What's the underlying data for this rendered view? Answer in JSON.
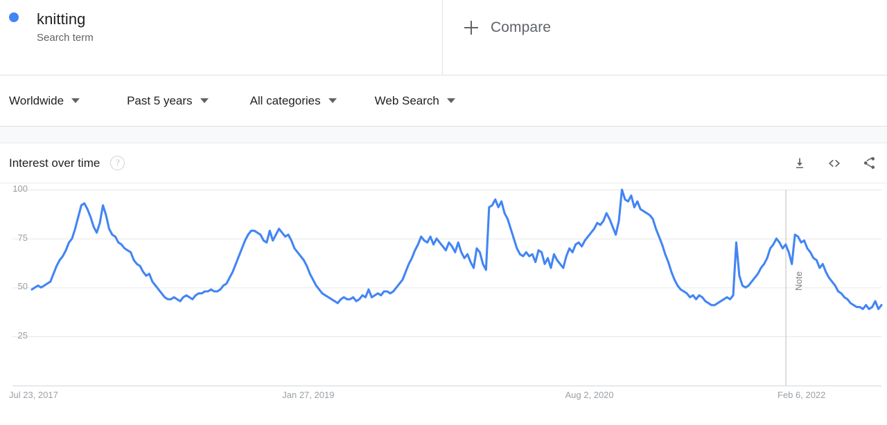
{
  "term": {
    "name": "knitting",
    "type_label": "Search term",
    "dot_color": "#4285f4"
  },
  "compare": {
    "label": "Compare",
    "icon": "plus-icon"
  },
  "filters": [
    {
      "label": "Worldwide",
      "icon": "chevron-down-icon"
    },
    {
      "label": "Past 5 years",
      "icon": "chevron-down-icon"
    },
    {
      "label": "All categories",
      "icon": "chevron-down-icon"
    },
    {
      "label": "Web Search",
      "icon": "chevron-down-icon"
    }
  ],
  "card": {
    "title": "Interest over time",
    "help_icon": "?",
    "actions": [
      {
        "name": "download-icon",
        "title": "Download CSV"
      },
      {
        "name": "embed-icon",
        "title": "Embed"
      },
      {
        "name": "share-icon",
        "title": "Share"
      }
    ]
  },
  "chart_data": {
    "type": "line",
    "title": "Interest over time",
    "xlabel": "",
    "ylabel": "",
    "ylim": [
      0,
      112
    ],
    "yticks": [
      100,
      75,
      50,
      25
    ],
    "xticks": [
      "Jul 23, 2017",
      "Jan 27, 2019",
      "Aug 2, 2020",
      "Feb 6, 2022"
    ],
    "xtick_positions": [
      0.0,
      0.333,
      0.666,
      1.0
    ],
    "grid": true,
    "legend": false,
    "line_color": "#4285f4",
    "annotations": [
      {
        "label": "Note",
        "x_fraction": 0.8875,
        "type": "vertical-line"
      }
    ],
    "series": [
      {
        "name": "knitting",
        "color": "#4285f4",
        "values": [
          49,
          50,
          51,
          50,
          51,
          52,
          53,
          57,
          61,
          64,
          66,
          69,
          73,
          75,
          80,
          86,
          92,
          93,
          90,
          86,
          81,
          78,
          83,
          92,
          87,
          80,
          77,
          76,
          73,
          72,
          70,
          69,
          68,
          64,
          62,
          61,
          58,
          56,
          57,
          53,
          51,
          49,
          47,
          45,
          44,
          44,
          45,
          44,
          43,
          45,
          46,
          45,
          44,
          46,
          47,
          47,
          48,
          48,
          49,
          48,
          48,
          49,
          51,
          52,
          55,
          58,
          62,
          66,
          70,
          74,
          77,
          79,
          79,
          78,
          77,
          74,
          73,
          79,
          74,
          77,
          80,
          78,
          76,
          77,
          74,
          70,
          68,
          66,
          64,
          61,
          57,
          54,
          51,
          49,
          47,
          46,
          45,
          44,
          43,
          42,
          44,
          45,
          44,
          44,
          45,
          43,
          44,
          46,
          45,
          49,
          45,
          46,
          47,
          46,
          48,
          48,
          47,
          48,
          50,
          52,
          54,
          58,
          62,
          65,
          69,
          72,
          76,
          74,
          73,
          76,
          72,
          75,
          73,
          71,
          69,
          73,
          71,
          68,
          73,
          68,
          65,
          67,
          63,
          60,
          70,
          68,
          62,
          59,
          91,
          92,
          95,
          91,
          94,
          88,
          85,
          80,
          75,
          70,
          67,
          66,
          68,
          66,
          67,
          63,
          69,
          68,
          62,
          65,
          60,
          67,
          64,
          62,
          60,
          66,
          70,
          68,
          72,
          73,
          71,
          74,
          76,
          78,
          80,
          83,
          82,
          84,
          88,
          85,
          81,
          77,
          84,
          100,
          95,
          94,
          97,
          91,
          94,
          90,
          89,
          88,
          87,
          85,
          80,
          76,
          72,
          67,
          63,
          58,
          54,
          51,
          49,
          48,
          47,
          45,
          46,
          44,
          46,
          45,
          43,
          42,
          41,
          41,
          42,
          43,
          44,
          45,
          44,
          46,
          73,
          56,
          51,
          50,
          51,
          53,
          55,
          57,
          60,
          62,
          65,
          70,
          72,
          75,
          73,
          70,
          72,
          68,
          62,
          77,
          76,
          73,
          74,
          70,
          68,
          65,
          64,
          60,
          62,
          58,
          55,
          53,
          51,
          48,
          47,
          45,
          44,
          42,
          41,
          40,
          40,
          39,
          41,
          39,
          40,
          43,
          39,
          41
        ]
      }
    ]
  }
}
